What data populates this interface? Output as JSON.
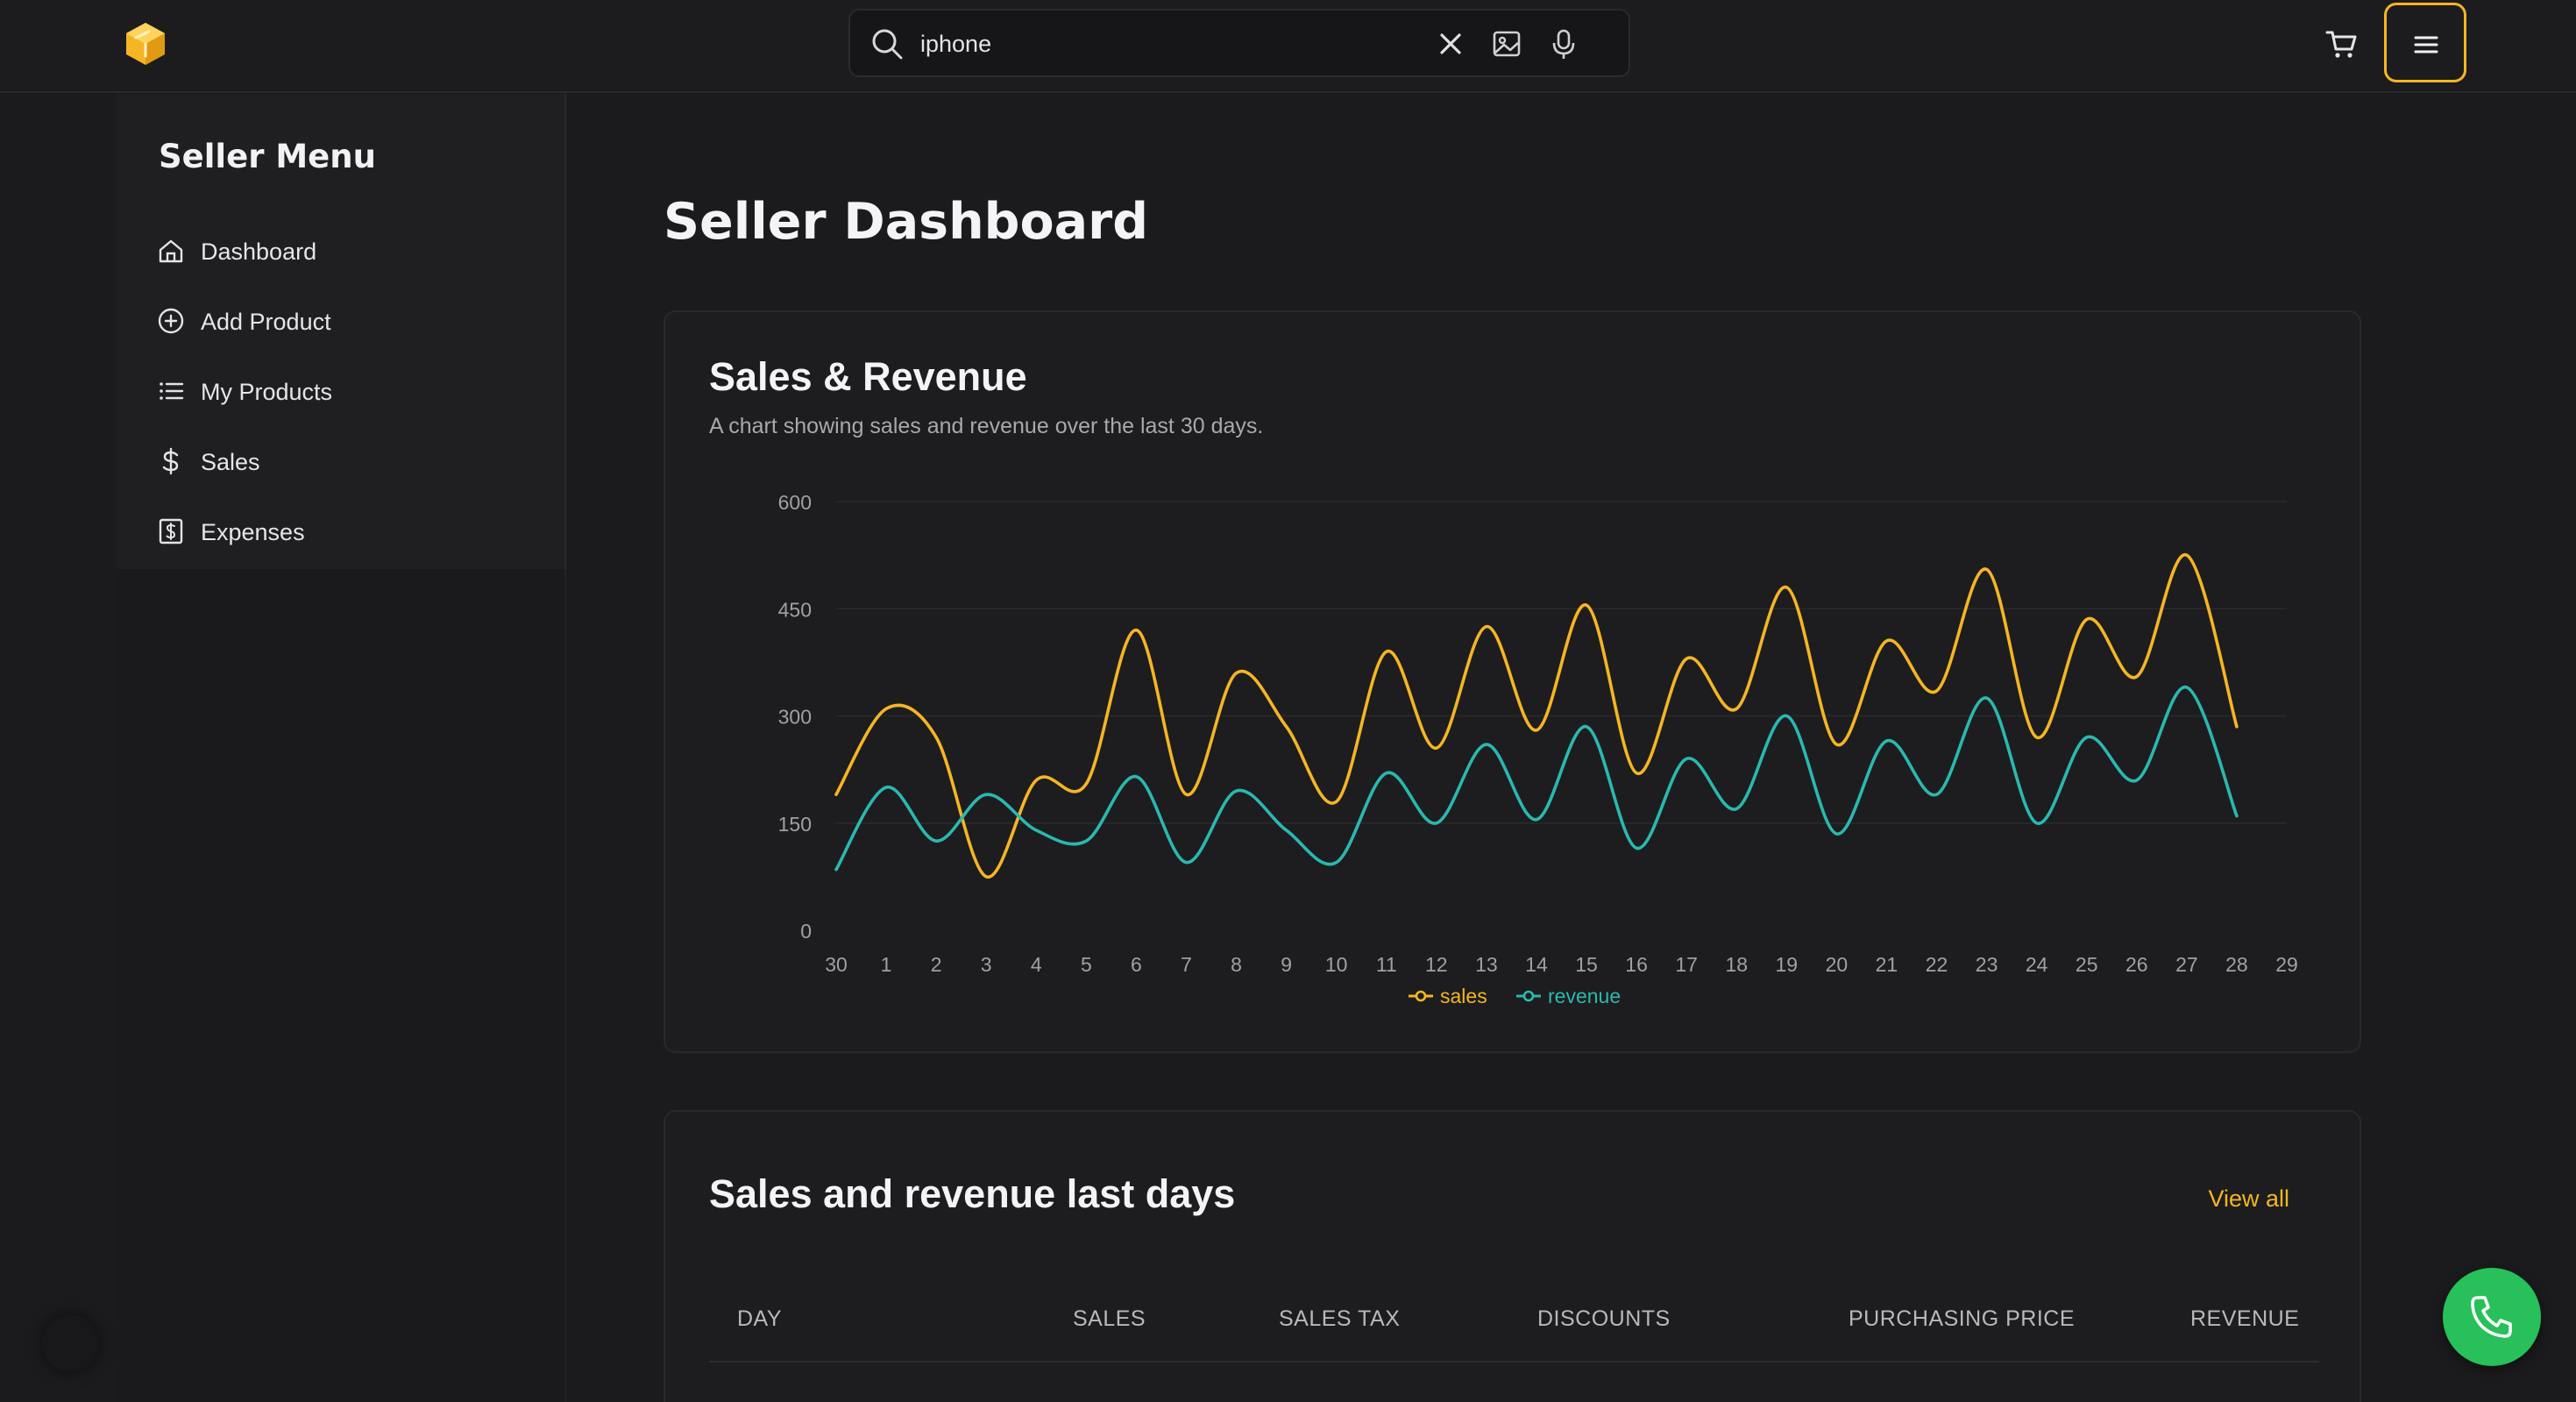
{
  "header": {
    "logo_icon": "cube-icon",
    "search": {
      "value": "iphone",
      "placeholder": ""
    },
    "icons": [
      "search-icon",
      "close-icon",
      "image-search-icon",
      "mic-icon",
      "cart-icon",
      "menu-icon"
    ]
  },
  "sidebar": {
    "title": "Seller Menu",
    "items": [
      {
        "label": "Dashboard",
        "icon": "home-icon"
      },
      {
        "label": "Add Product",
        "icon": "plus-circle-icon"
      },
      {
        "label": "My Products",
        "icon": "list-icon"
      },
      {
        "label": "Sales",
        "icon": "dollar-icon"
      },
      {
        "label": "Expenses",
        "icon": "receipt-icon"
      }
    ]
  },
  "main": {
    "title": "Seller Dashboard",
    "chart_card": {
      "title": "Sales & Revenue",
      "subtitle": "A chart showing sales and revenue over the last 30 days."
    },
    "table_card": {
      "title": "Sales and revenue last days",
      "view_all": "View all",
      "columns": [
        "DAY",
        "SALES",
        "SALES TAX",
        "DISCOUNTS",
        "PURCHASING PRICE",
        "REVENUE"
      ]
    }
  },
  "colors": {
    "accent": "#f5b524",
    "sales": "#f5b524",
    "revenue": "#2bb8b0",
    "call": "#27c05a"
  },
  "chart_data": {
    "type": "line",
    "title": "",
    "xlabel": "",
    "ylabel": "",
    "ylim": [
      0,
      600
    ],
    "yticks": [
      0,
      150,
      300,
      450,
      600
    ],
    "x": [
      "30",
      "1",
      "2",
      "3",
      "4",
      "5",
      "6",
      "7",
      "8",
      "9",
      "10",
      "11",
      "12",
      "13",
      "14",
      "15",
      "16",
      "17",
      "18",
      "19",
      "20",
      "21",
      "22",
      "23",
      "24",
      "25",
      "26",
      "27",
      "28",
      "29"
    ],
    "series": [
      {
        "name": "sales",
        "color": "#f5b524",
        "values": [
          190,
          310,
          270,
          75,
          210,
          205,
          420,
          190,
          360,
          285,
          180,
          390,
          255,
          425,
          280,
          455,
          220,
          380,
          310,
          480,
          260,
          405,
          335,
          505,
          270,
          435,
          355,
          525,
          285
        ]
      },
      {
        "name": "revenue",
        "color": "#2bb8b0",
        "values": [
          85,
          200,
          125,
          190,
          140,
          125,
          215,
          95,
          195,
          140,
          95,
          220,
          150,
          260,
          155,
          285,
          115,
          240,
          170,
          300,
          135,
          265,
          190,
          325,
          150,
          270,
          210,
          340,
          160
        ]
      }
    ],
    "legend": "bottom-center",
    "grid": true
  }
}
